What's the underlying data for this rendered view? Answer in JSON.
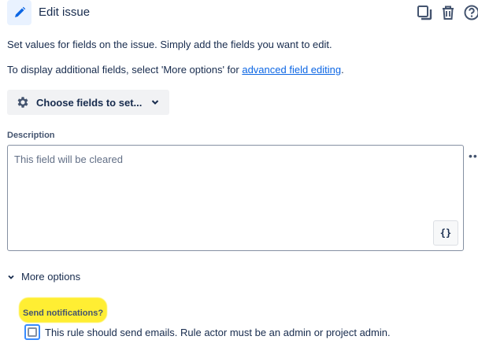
{
  "header": {
    "title": "Edit issue",
    "icon": "pencil-icon",
    "actions": [
      "duplicate-icon",
      "trash-icon",
      "help-icon"
    ]
  },
  "intro": {
    "line1": "Set values for fields on the issue. Simply add the fields you want to edit.",
    "line2_prefix": "To display additional fields, select 'More options' for ",
    "line2_link": "advanced field editing",
    "line2_suffix": "."
  },
  "choose_fields": {
    "label": "Choose fields to set..."
  },
  "description": {
    "label": "Description",
    "value": "",
    "placeholder": "This field will be cleared",
    "smart_value_button": "{}",
    "more_menu": "••"
  },
  "more_options": {
    "label": "More options"
  },
  "notifications": {
    "label": "Send notifications?",
    "checkbox_label": "This rule should send emails. Rule actor must be an admin or project admin.",
    "checked": false
  },
  "colors": {
    "link": "#0c66e4",
    "highlight": "#ffee33",
    "focus": "#388bff"
  }
}
